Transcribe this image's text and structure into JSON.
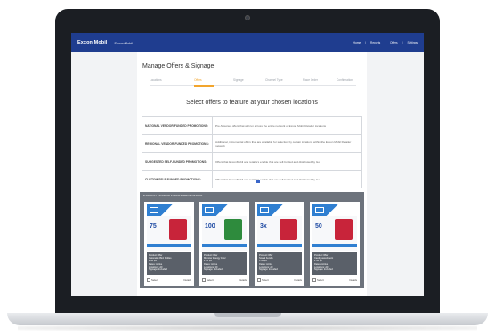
{
  "nav": {
    "brand": "Exxon Mobil",
    "brand_secondary": "ExxonMobil",
    "links": [
      "Home",
      "Reports",
      "Offers",
      "Settings"
    ]
  },
  "page": {
    "title": "Manage Offers & Signage",
    "subtitle": "Select offers to feature at your chosen locations"
  },
  "steps": [
    {
      "label": "Locations",
      "active": false
    },
    {
      "label": "Offers",
      "active": true
    },
    {
      "label": "Signage",
      "active": false
    },
    {
      "label": "Channel Type",
      "active": false
    },
    {
      "label": "Place Order",
      "active": false
    },
    {
      "label": "Confirmation",
      "active": false
    }
  ],
  "promo_types": [
    {
      "key": "NATIONAL VENDOR-FUNDED PROMOTIONS:",
      "value": "Pre-Selected offers that will run across the entire network of Exxon Mobil Retailer locations"
    },
    {
      "key": "REGIONAL VENDOR-FUNDED PROMOTIONS:",
      "value": "Additional, incremental offers that are available for selection by certain locations within the Exxon Mobil Retailer network"
    },
    {
      "key": "SUGGESTED SELF-FUNDED PROMOTIONS:",
      "value": "Offers that ExxonMobil and retailers enable that are self-funded and distributed by Go"
    },
    {
      "key": "CUSTOM SELF-FUNDED PROMOTIONS:",
      "value": "Offers that ExxonMobil and retailers enable that are self-funded and distributed by Go"
    }
  ],
  "offers_panel": {
    "header": "NATIONAL VENDOR-FUNDED PROMOTIONS",
    "cards": [
      {
        "price": "75",
        "product_color": "#c8243a",
        "info": [
          "Product Offer",
          "Gatorade 28oz bottles",
          "2 for $3",
          "Dates: Active",
          "Locations: All",
          "Signage: Included"
        ],
        "select": "Select",
        "details": "Details"
      },
      {
        "price": "100",
        "product_color": "#2e8b3d",
        "info": [
          "Product Offer",
          "Monster Energy 16oz",
          "2 for $4",
          "Dates: Active",
          "Locations: All",
          "Signage: Included"
        ],
        "select": "Select",
        "details": "Details"
      },
      {
        "price": "3x",
        "product_color": "#c8243a",
        "info": [
          "Product Offer",
          "Snack bundle",
          "3 for $5",
          "Dates: Active",
          "Locations: All",
          "Signage: Included"
        ],
        "select": "Select",
        "details": "Details"
      },
      {
        "price": "50",
        "product_color": "#c8243a",
        "info": [
          "Product Offer",
          "Candy assortment",
          "2 for $2",
          "Dates: Active",
          "Locations: All",
          "Signage: Included"
        ],
        "select": "Select",
        "details": "Details"
      }
    ]
  },
  "colors": {
    "nav": "#1f3d8f",
    "accent": "#f2a52d",
    "brand_blue": "#2f7fd1",
    "panel": "#6d737c"
  }
}
